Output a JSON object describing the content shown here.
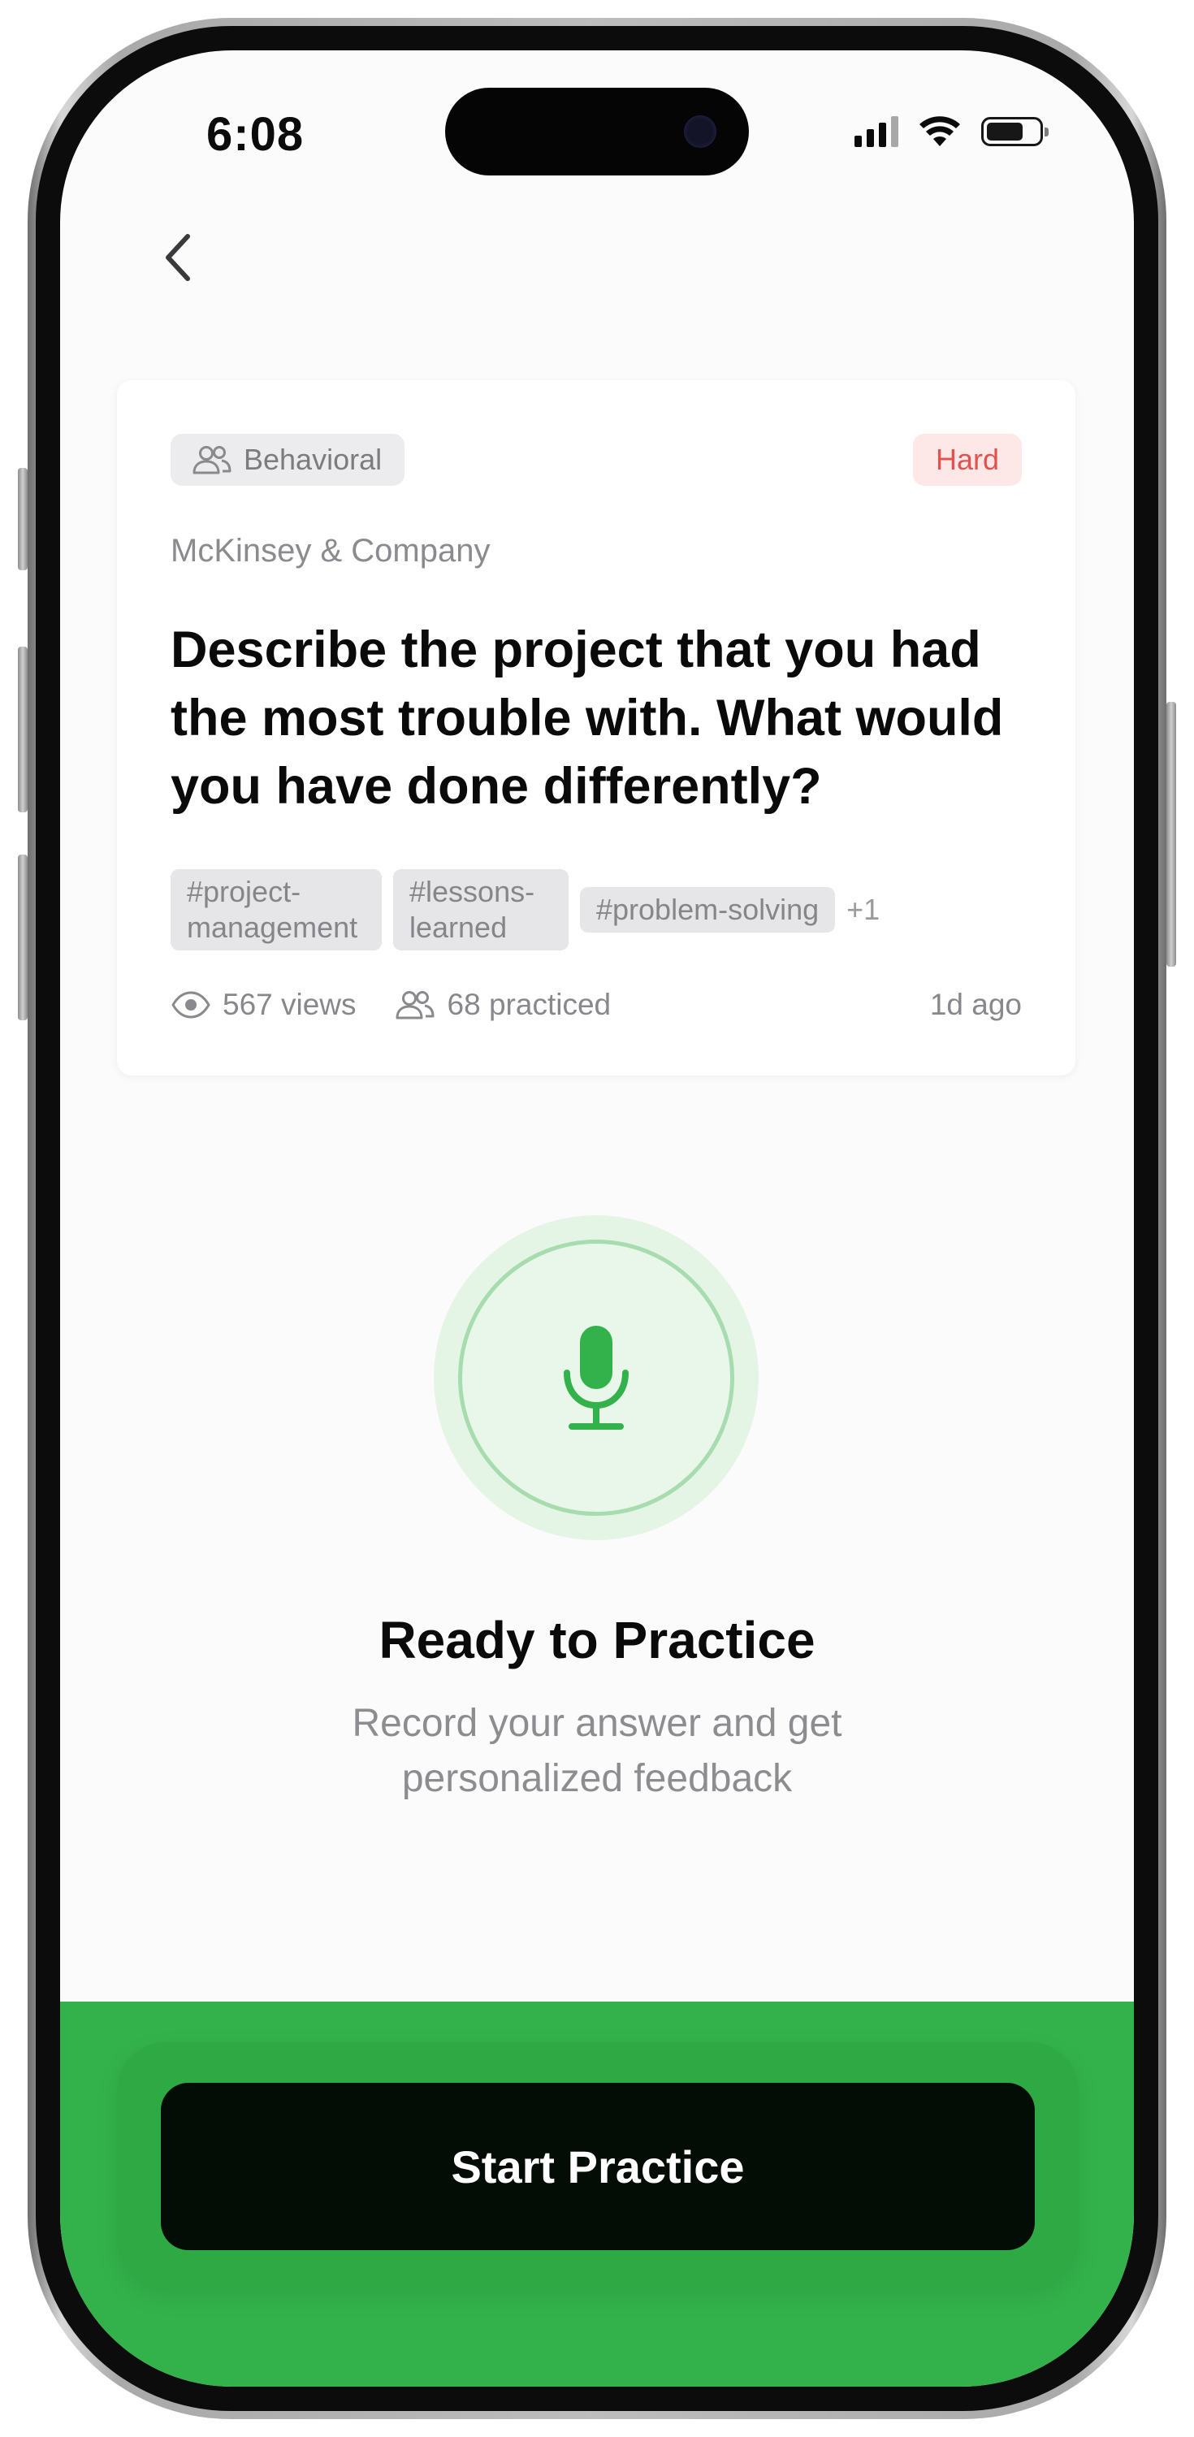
{
  "status_bar": {
    "time": "6:08"
  },
  "navigation": {
    "back_icon": "chevron-left-icon"
  },
  "question_card": {
    "category": "Behavioral",
    "category_icon": "people-icon",
    "difficulty": "Hard",
    "difficulty_color": "#e2524f",
    "company": "McKinsey & Company",
    "question": "Describe the project that you had the most trouble with. What would you have done differently?",
    "tags": [
      "#project-management",
      "#lessons-learned",
      "#problem-solving"
    ],
    "tags_more": "+1",
    "views": "567 views",
    "practiced": "68 practiced",
    "posted": "1d ago"
  },
  "practice": {
    "mic_icon": "microphone-icon",
    "title": "Ready to Practice",
    "subtitle": "Record your answer and get personalized feedback"
  },
  "footer": {
    "start_label": "Start Practice",
    "accent_color": "#33b24b"
  }
}
